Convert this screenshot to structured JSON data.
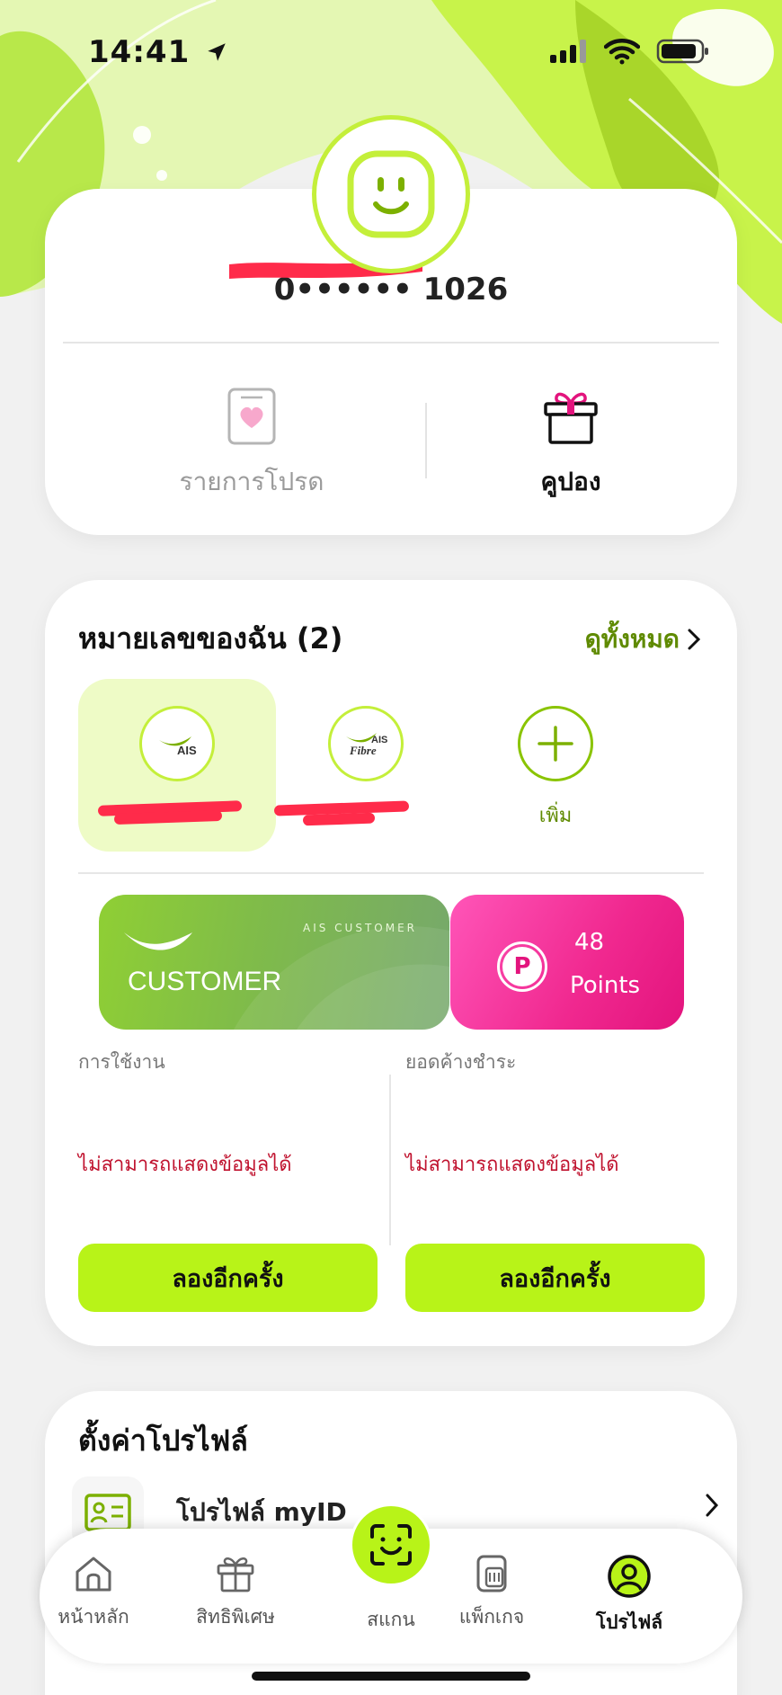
{
  "status_bar": {
    "time": "14:41"
  },
  "profile": {
    "name": "0•••••• 1026",
    "wishlist_label": "รายการโปรด",
    "coupon_label": "คูปอง"
  },
  "numbers": {
    "title": "หมายเลขของฉัน (2)",
    "view_all": "ดูทั้งหมด",
    "tiles": [
      {
        "logo": "AIS"
      },
      {
        "logo_top": "AIS",
        "logo_bottom": "Fibre"
      }
    ],
    "add_label": "เพิ่ม"
  },
  "membership": {
    "card_small": "AIS CUSTOMER",
    "card_big": "CUSTOMER",
    "points_icon": "P",
    "points_value": "48",
    "points_label": "Points"
  },
  "usage": {
    "usage_label": "การใช้งาน",
    "balance_label": "ยอดค้างชำระ",
    "error_text": "ไม่สามารถแสดงข้อมูลได้",
    "retry_label": "ลองอีกครั้ง"
  },
  "settings": {
    "title": "ตั้งค่าโปรไฟล์",
    "myid_label": "โปรไฟล์ myID"
  },
  "tab_bar": {
    "home": "หน้าหลัก",
    "privileges": "สิทธิพิเศษ",
    "scan": "สแกน",
    "packages": "แพ็กเกจ",
    "profile": "โปรไฟล์",
    "active_tab": "profile"
  },
  "colors": {
    "brand_lime": "#b8f318",
    "brand_green_text": "#5f8a00",
    "points_pink": "#e3147d",
    "error_red": "#c0132f"
  }
}
